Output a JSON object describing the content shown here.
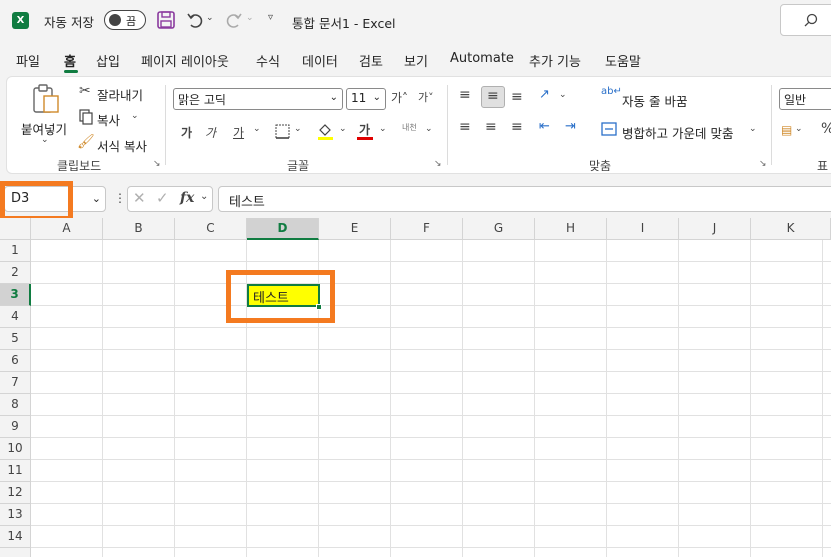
{
  "title_bar": {
    "autosave_label": "자동 저장",
    "autosave_state": "끔",
    "document_title": "통합 문서1  -  Excel"
  },
  "tabs": [
    "파일",
    "홈",
    "삽입",
    "페이지 레이아웃",
    "수식",
    "데이터",
    "검토",
    "보기",
    "Automate",
    "추가 기능",
    "도움말"
  ],
  "active_tab": "홈",
  "ribbon": {
    "clipboard": {
      "paste": "붙여넣기",
      "cut": "잘라내기",
      "copy": "복사",
      "format_painter": "서식 복사",
      "group_label": "클립보드"
    },
    "font": {
      "font_name": "맑은 고딕",
      "font_size": "11",
      "group_label": "글꼴"
    },
    "alignment": {
      "wrap_text": "자동 줄 바꿈",
      "merge_center": "병합하고 가운데 맞춤",
      "group_label": "맞춤"
    },
    "number": {
      "format": "일반",
      "group_label": "표"
    }
  },
  "formula_bar": {
    "name_box": "D3",
    "fx": "fx",
    "formula": "테스트"
  },
  "sheet": {
    "columns": [
      "A",
      "B",
      "C",
      "D",
      "E",
      "F",
      "G",
      "H",
      "I",
      "J",
      "K"
    ],
    "rows": [
      "1",
      "2",
      "3",
      "4",
      "5",
      "6",
      "7",
      "8",
      "9",
      "10",
      "11",
      "12",
      "13",
      "14"
    ],
    "active_cell": {
      "ref": "D3",
      "value": "테스트",
      "fill": "#ffff00"
    }
  },
  "colors": {
    "accent": "#107c41",
    "highlight": "#f47a20"
  }
}
